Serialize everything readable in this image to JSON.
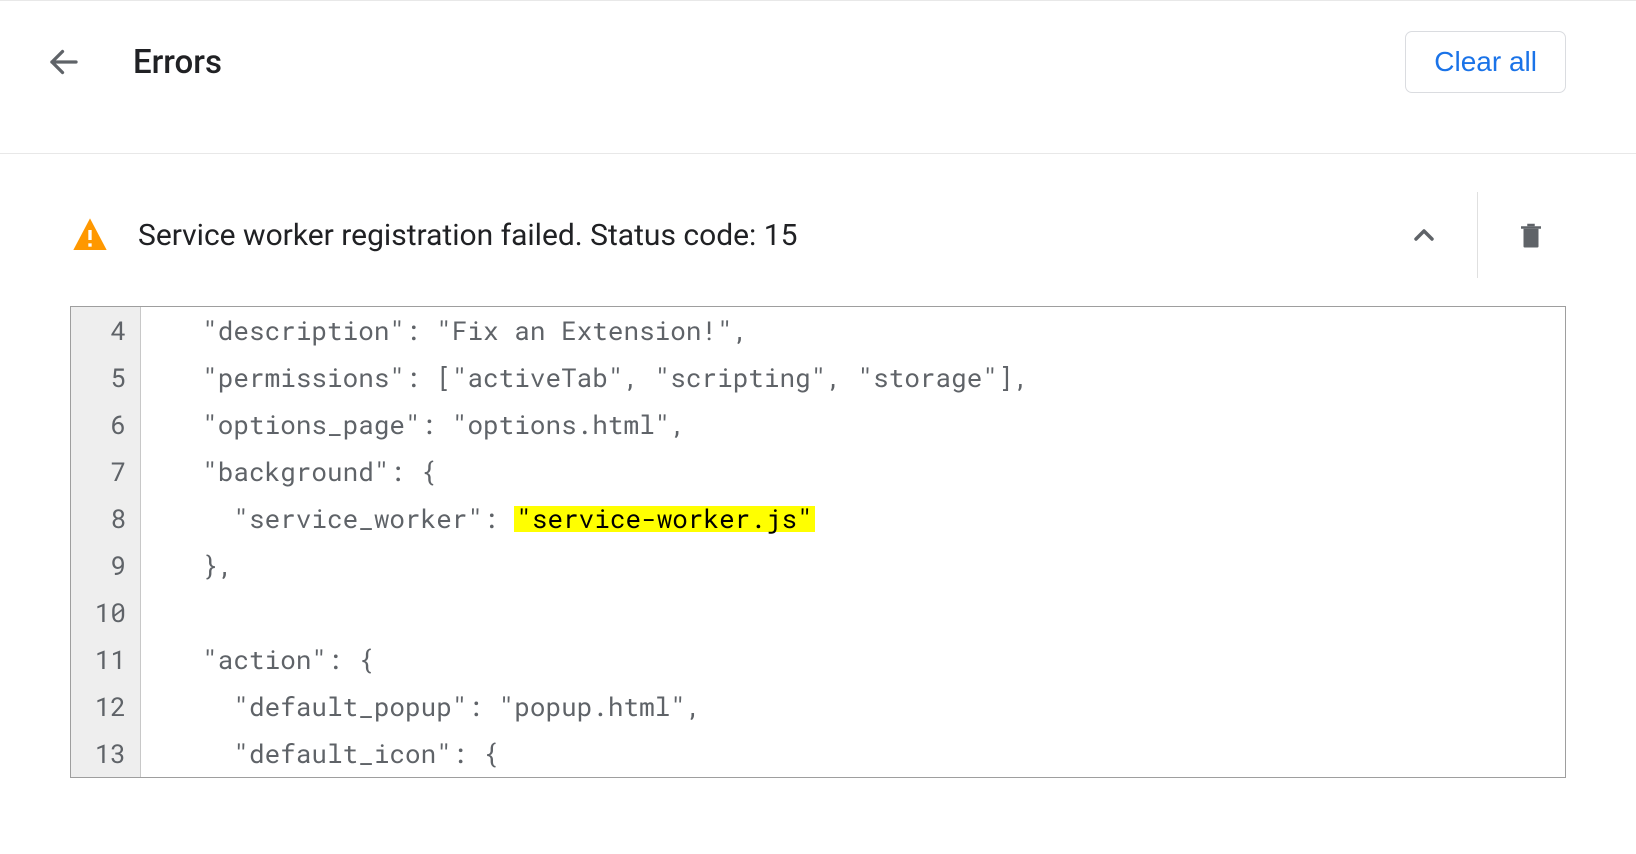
{
  "header": {
    "title": "Errors",
    "clear_all_label": "Clear all"
  },
  "error": {
    "message": "Service worker registration failed. Status code: 15",
    "code_lines": [
      {
        "n": 4,
        "indent": "  ",
        "text": "\"description\": \"Fix an Extension!\","
      },
      {
        "n": 5,
        "indent": "  ",
        "text": "\"permissions\": [\"activeTab\", \"scripting\", \"storage\"],"
      },
      {
        "n": 6,
        "indent": "  ",
        "text": "\"options_page\": \"options.html\","
      },
      {
        "n": 7,
        "indent": "  ",
        "text": "\"background\": {"
      },
      {
        "n": 8,
        "indent": "    ",
        "prefix": "\"service_worker\": ",
        "highlight": "\"service-worker.js\"",
        "suffix": ""
      },
      {
        "n": 9,
        "indent": "  ",
        "text": "},"
      },
      {
        "n": 10,
        "indent": "",
        "text": ""
      },
      {
        "n": 11,
        "indent": "  ",
        "text": "\"action\": {"
      },
      {
        "n": 12,
        "indent": "    ",
        "text": "\"default_popup\": \"popup.html\","
      },
      {
        "n": 13,
        "indent": "    ",
        "text": "\"default_icon\": {"
      }
    ]
  }
}
